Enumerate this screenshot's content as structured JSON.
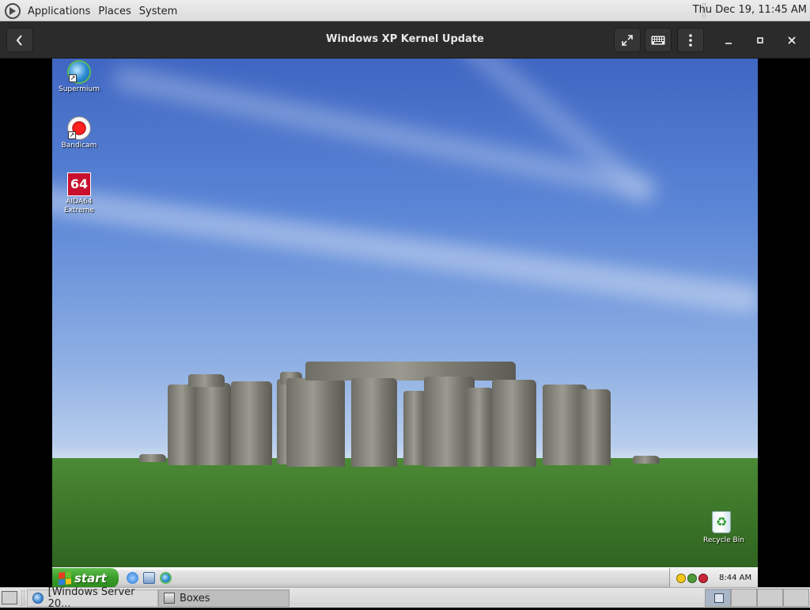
{
  "top_panel": {
    "menus": [
      "Applications",
      "Places",
      "System"
    ],
    "clock": "Thu Dec 19, 11:45 AM",
    "logo_icon": "gnome-foot-icon"
  },
  "window": {
    "title": "Windows XP Kernel Update",
    "buttons": {
      "back": "back-arrow-icon",
      "fullscreen": "fullscreen-icon",
      "keyboard": "keyboard-icon",
      "menu": "vertical-dots-icon",
      "minimize": "minimize-icon",
      "maximize": "maximize-icon",
      "close": "close-icon"
    },
    "header_color": "#2b2b2b"
  },
  "guest": {
    "desktop_icons": [
      {
        "label": "Supermium",
        "icon": "supermium-icon"
      },
      {
        "label": "Bandicam",
        "icon": "bandicam-icon"
      },
      {
        "label": "AIDA64 Extreme",
        "icon": "aida64-icon",
        "glyph": "64"
      },
      {
        "label": "Recycle Bin",
        "icon": "recycle-bin-icon"
      }
    ],
    "taskbar": {
      "start_label": "start",
      "quick_launch": [
        "internet-explorer-icon",
        "show-desktop-icon",
        "supermium-icon"
      ],
      "tray_icons": [
        "security-alert-icon",
        "network-icon",
        "shield-icon"
      ],
      "clock": "8:44 AM",
      "start_color": "#3c9f2b"
    }
  },
  "bottom_panel": {
    "tasks": [
      {
        "label": "[Windows Server 20...",
        "icon": "browser-icon",
        "active": false
      },
      {
        "label": "Boxes",
        "icon": "boxes-icon",
        "active": true
      }
    ],
    "workspaces": 4,
    "active_workspace": 1
  }
}
